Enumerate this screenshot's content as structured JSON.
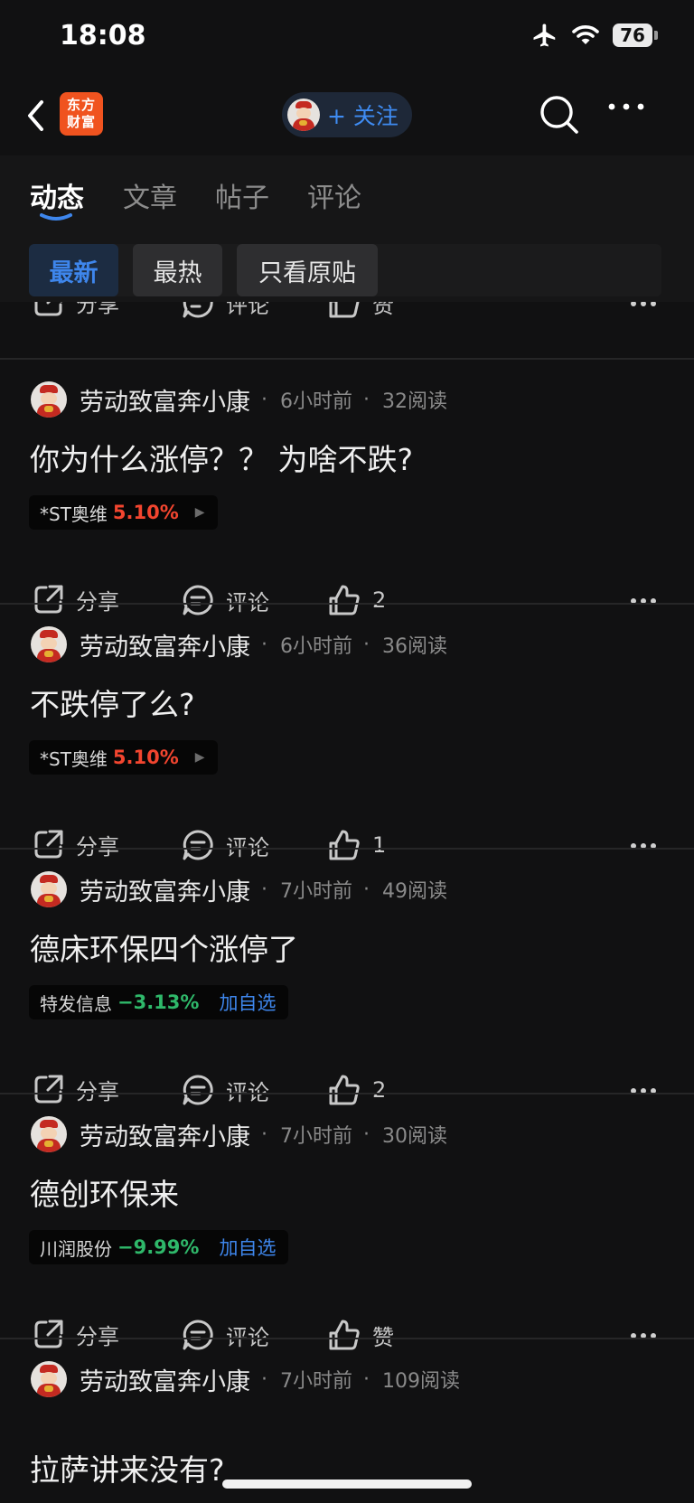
{
  "status_bar": {
    "time": "18:08",
    "battery": "76"
  },
  "nav": {
    "logo_line1": "东方",
    "logo_line2": "财富",
    "follow_label": "+ 关注"
  },
  "tabs": [
    {
      "label": "动态",
      "active": true
    },
    {
      "label": "文章",
      "active": false
    },
    {
      "label": "帖子",
      "active": false
    },
    {
      "label": "评论",
      "active": false
    }
  ],
  "filters": [
    {
      "label": "最新",
      "active": true
    },
    {
      "label": "最热",
      "active": false
    },
    {
      "label": "只看原贴",
      "active": false
    }
  ],
  "top_partial": {
    "share": "分享",
    "comment": "评论",
    "like": "赞"
  },
  "posts": [
    {
      "author": "劳动致富奔小康",
      "time": "6小时前",
      "reads": "32阅读",
      "title": "你为什么涨停？？ 为啥不跌?",
      "stock": {
        "name": "*ST奥维",
        "change": "5.10%",
        "direction": "up",
        "add_label": ""
      },
      "share": "分享",
      "comment": "评论",
      "like": "2"
    },
    {
      "author": "劳动致富奔小康",
      "time": "6小时前",
      "reads": "36阅读",
      "title": "不跌停了么?",
      "stock": {
        "name": "*ST奥维",
        "change": "5.10%",
        "direction": "up",
        "add_label": ""
      },
      "share": "分享",
      "comment": "评论",
      "like": "1"
    },
    {
      "author": "劳动致富奔小康",
      "time": "7小时前",
      "reads": "49阅读",
      "title": "德床环保四个涨停了",
      "stock": {
        "name": "特发信息",
        "change": "−3.13%",
        "direction": "down",
        "add_label": "加自选"
      },
      "share": "分享",
      "comment": "评论",
      "like": "2"
    },
    {
      "author": "劳动致富奔小康",
      "time": "7小时前",
      "reads": "30阅读",
      "title": "德创环保来",
      "stock": {
        "name": "川润股份",
        "change": "−9.99%",
        "direction": "down",
        "add_label": "加自选"
      },
      "share": "分享",
      "comment": "评论",
      "like": "赞"
    },
    {
      "author": "劳动致富奔小康",
      "time": "7小时前",
      "reads": "109阅读",
      "title": "拉萨讲来没有?"
    }
  ],
  "colors": {
    "background": "#111112",
    "accent_blue": "#3e86ec",
    "up_red": "#f2452f",
    "down_green": "#2fb86a",
    "logo_orange": "#f0531f"
  },
  "icons": [
    "back-chevron-icon",
    "airplane-icon",
    "wifi-icon",
    "search-icon",
    "more-dots-icon",
    "share-icon",
    "comment-icon",
    "thumbs-up-icon",
    "play-triangle-icon"
  ]
}
